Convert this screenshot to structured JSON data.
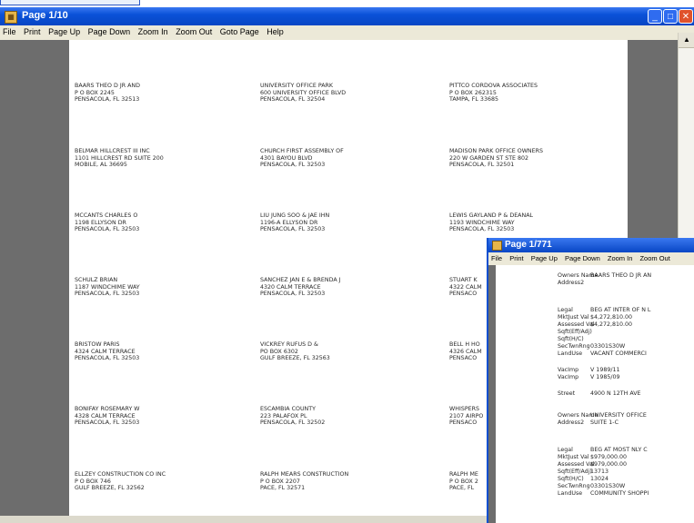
{
  "main_window": {
    "title": "Page 1/10",
    "menu": [
      "File",
      "Print",
      "Page Up",
      "Page Down",
      "Zoom In",
      "Zoom Out",
      "Goto Page",
      "Help"
    ],
    "labels": [
      {
        "lines": [
          "BAARS THEO D JR AND",
          "P O BOX 2245",
          "PENSACOLA, FL 32513"
        ]
      },
      {
        "lines": [
          "UNIVERSITY OFFICE PARK",
          "600 UNIVERSITY OFFICE BLVD",
          "PENSACOLA, FL 32504"
        ]
      },
      {
        "lines": [
          "PITTCO CORDOVA ASSOCIATES",
          "P O BOX 262315",
          "TAMPA, FL 33685"
        ]
      },
      {
        "lines": [
          "BELMAR HILLCREST III INC",
          "1101 HILLCREST RD SUITE 200",
          "MOBILE, AL 36695"
        ]
      },
      {
        "lines": [
          "CHURCH FIRST ASSEMBLY OF",
          "4301 BAYOU BLVD",
          "PENSACOLA, FL 32503"
        ]
      },
      {
        "lines": [
          "MADISON PARK OFFICE OWNERS",
          "220 W GARDEN ST STE 802",
          "PENSACOLA, FL 32501"
        ]
      },
      {
        "lines": [
          "MCCANTS CHARLES O",
          "1198 ELLYSON DR",
          "PENSACOLA, FL 32503"
        ]
      },
      {
        "lines": [
          "LIU JUNG SOO & JAE IHN",
          "1196-A ELLYSON DR",
          "PENSACOLA, FL 32503"
        ]
      },
      {
        "lines": [
          "LEWIS GAYLAND P & DEANAL",
          "1193 WINDCHIME WAY",
          "PENSACOLA, FL 32503"
        ]
      },
      {
        "lines": [
          "SCHULZ BRIAN",
          "1187 WINDCHIME WAY",
          "PENSACOLA, FL 32503"
        ]
      },
      {
        "lines": [
          "SANCHEZ JAN E & BRENDA J",
          "4320 CALM TERRACE",
          "PENSACOLA, FL 32503"
        ]
      },
      {
        "lines": [
          "STUART K",
          "4322 CALM",
          "PENSACO"
        ]
      },
      {
        "lines": [
          "BRISTOW PARIS",
          "4324 CALM TERRACE",
          "PENSACOLA, FL 32503"
        ]
      },
      {
        "lines": [
          "VICKREY RUFUS D &",
          "PO BOX 6302",
          "GULF BREEZE, FL 32563"
        ]
      },
      {
        "lines": [
          "BELL H HO",
          "4326 CALM",
          "PENSACO"
        ]
      },
      {
        "lines": [
          "BONIFAY ROSEMARY W",
          "4328 CALM TERRACE",
          "PENSACOLA, FL 32503"
        ]
      },
      {
        "lines": [
          "ESCAMBIA COUNTY",
          "223 PALAFOX PL",
          "PENSACOLA, FL 32502"
        ]
      },
      {
        "lines": [
          "WHISPERS",
          "2107 AIRPO",
          "PENSACO"
        ]
      },
      {
        "lines": [
          "ELLZEY CONSTRUCTION CO INC",
          "P O BOX 746",
          "GULF BREEZE, FL 32562"
        ]
      },
      {
        "lines": [
          "RALPH MEARS CONSTRUCTION",
          "P O BOX 2207",
          "PACE, FL 32571"
        ]
      },
      {
        "lines": [
          "RALPH ME",
          "P O BOX 2",
          "PACE, FL"
        ]
      }
    ]
  },
  "detail_window": {
    "title": "Page 1/771",
    "menu": [
      "File",
      "Print",
      "Page Up",
      "Page Down",
      "Zoom In",
      "Zoom Out"
    ],
    "record1": {
      "owners_name_label": "Owners Name",
      "owners_name": "BAARS THEO D JR AN",
      "address2_label": "Address2",
      "legal_label": "Legal",
      "legal": "BEG AT INTER OF N L",
      "mkt_label": "MktJust Val",
      "mkt": "$4,272,810.00",
      "assessed_label": "Assessed Val",
      "assessed": "$4,272,810.00",
      "sqft_eff_label": "Sqft(Eff/Adj)",
      "sqft_hc_label": "Sqft(H/C)",
      "sectwn_label": "SecTwnRng",
      "sectwn": "03301S30W",
      "landuse_label": "LandUse",
      "landuse": "VACANT COMMERCI",
      "vacimp1_label": "VacImp",
      "vacimp1": "V 1989/11",
      "vacimp2_label": "VacImp",
      "vacimp2": "V 1985/09",
      "street_label": "Street",
      "street": "4900 N 12TH AVE"
    },
    "record2": {
      "owners_name_label": "Owners Name",
      "owners_name": "UNIVERSITY OFFICE",
      "address2_label": "Address2",
      "address2": "SUITE 1-C",
      "legal_label": "Legal",
      "legal": "BEG AT MOST NLY C",
      "mkt_label": "MktJust Val",
      "mkt": "$979,000.00",
      "assessed_label": "Assessed Val",
      "assessed": "$979,000.00",
      "sqft_eff_label": "Sqft(Eff/Adj)",
      "sqft_eff": "13713",
      "sqft_hc_label": "Sqft(H/C)",
      "sqft_hc": "13024",
      "sectwn_label": "SecTwnRng",
      "sectwn": "03301S30W",
      "landuse_label": "LandUse",
      "landuse": "COMMUNITY SHOPPI"
    }
  }
}
